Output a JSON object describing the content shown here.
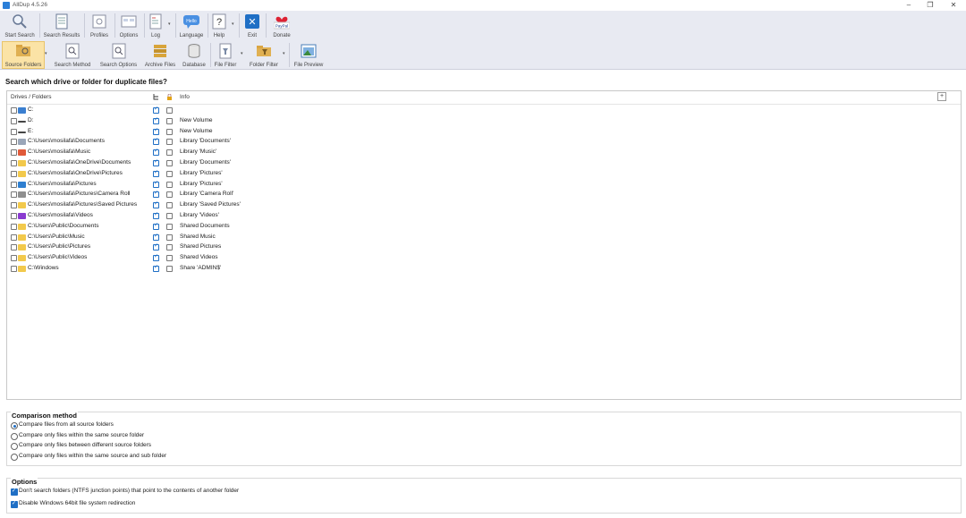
{
  "window": {
    "title": "AllDup 4.5.26",
    "minimize": "–",
    "maximize": "❐",
    "close": "✕"
  },
  "toolbar_row1": [
    {
      "label": "Start Search",
      "icon": "magnifier-icon"
    },
    {
      "label": "Search Results",
      "icon": "results-icon"
    },
    {
      "label": "Profiles",
      "icon": "profiles-icon"
    },
    {
      "label": "Options",
      "icon": "options-icon"
    },
    {
      "label": "Log",
      "icon": "log-icon"
    },
    {
      "label": "Language",
      "icon": "hello-bubble-icon",
      "badge": "Hello"
    },
    {
      "label": "Help",
      "icon": "help-icon",
      "glyph": "?"
    },
    {
      "label": "Exit",
      "icon": "exit-icon",
      "glyph": "✕"
    },
    {
      "label": "Donate",
      "icon": "paypal-heart-icon",
      "badge": "PayPal"
    }
  ],
  "toolbar_row2": [
    {
      "label": "Source Folders",
      "icon": "source-folders-icon",
      "active": true
    },
    {
      "label": "Search Method",
      "icon": "search-method-icon"
    },
    {
      "label": "Search Options",
      "icon": "search-options-icon"
    },
    {
      "label": "Archive Files",
      "icon": "archive-files-icon"
    },
    {
      "label": "Database",
      "icon": "database-icon"
    },
    {
      "label": "File Filter",
      "icon": "file-filter-icon"
    },
    {
      "label": "Folder Filter",
      "icon": "folder-filter-icon"
    },
    {
      "label": "File Preview",
      "icon": "file-preview-icon"
    }
  ],
  "heading": "Search which drive or folder for duplicate files?",
  "tree": {
    "columns": {
      "drives": "Drives / Folders",
      "info": "Info",
      "plus": "+"
    },
    "rows": [
      {
        "path": "C:",
        "info": "",
        "icon": "windows-drive-icon"
      },
      {
        "path": "D:",
        "info": "New Volume",
        "icon": "drive-icon"
      },
      {
        "path": "E:",
        "info": "New Volume",
        "icon": "drive-icon"
      },
      {
        "path": "C:\\Users\\mosilafa\\Documents",
        "info": "Library 'Documents'",
        "icon": "documents-icon"
      },
      {
        "path": "C:\\Users\\mosilafa\\Music",
        "info": "Library 'Music'",
        "icon": "music-icon"
      },
      {
        "path": "C:\\Users\\mosilafa\\OneDrive\\Documents",
        "info": "Library 'Documents'",
        "icon": "folder-icon"
      },
      {
        "path": "C:\\Users\\mosilafa\\OneDrive\\Pictures",
        "info": "Library 'Pictures'",
        "icon": "folder-icon"
      },
      {
        "path": "C:\\Users\\mosilafa\\Pictures",
        "info": "Library 'Pictures'",
        "icon": "pictures-icon"
      },
      {
        "path": "C:\\Users\\mosilafa\\Pictures\\Camera Roll",
        "info": "Library 'Camera Roll'",
        "icon": "camera-roll-folder-icon"
      },
      {
        "path": "C:\\Users\\mosilafa\\Pictures\\Saved Pictures",
        "info": "Library 'Saved Pictures'",
        "icon": "folder-icon"
      },
      {
        "path": "C:\\Users\\mosilafa\\Videos",
        "info": "Library 'Videos'",
        "icon": "videos-icon"
      },
      {
        "path": "C:\\Users\\Public\\Documents",
        "info": "Shared Documents",
        "icon": "folder-icon"
      },
      {
        "path": "C:\\Users\\Public\\Music",
        "info": "Shared Music",
        "icon": "folder-icon"
      },
      {
        "path": "C:\\Users\\Public\\Pictures",
        "info": "Shared Pictures",
        "icon": "folder-icon"
      },
      {
        "path": "C:\\Users\\Public\\Videos",
        "info": "Shared Videos",
        "icon": "folder-icon"
      },
      {
        "path": "C:\\Windows",
        "info": "Share 'ADMIN$'",
        "icon": "folder-icon"
      }
    ]
  },
  "comparison": {
    "title": "Comparison method",
    "options": [
      "Compare files from all source folders",
      "Compare only files within the same source folder",
      "Compare only files between different source folders",
      "Compare only files within the same source and sub folder"
    ],
    "selected_index": 0
  },
  "options": {
    "title": "Options",
    "items": [
      "Don't search folders (NTFS junction points) that point to the contents of another folder",
      "Disable Windows 64bit file system redirection"
    ]
  },
  "colors": {
    "accent": "#1f6fc5",
    "ribbon": "#e8eaf2",
    "active": "#fbe3a6",
    "folder": "#f2c94c"
  }
}
